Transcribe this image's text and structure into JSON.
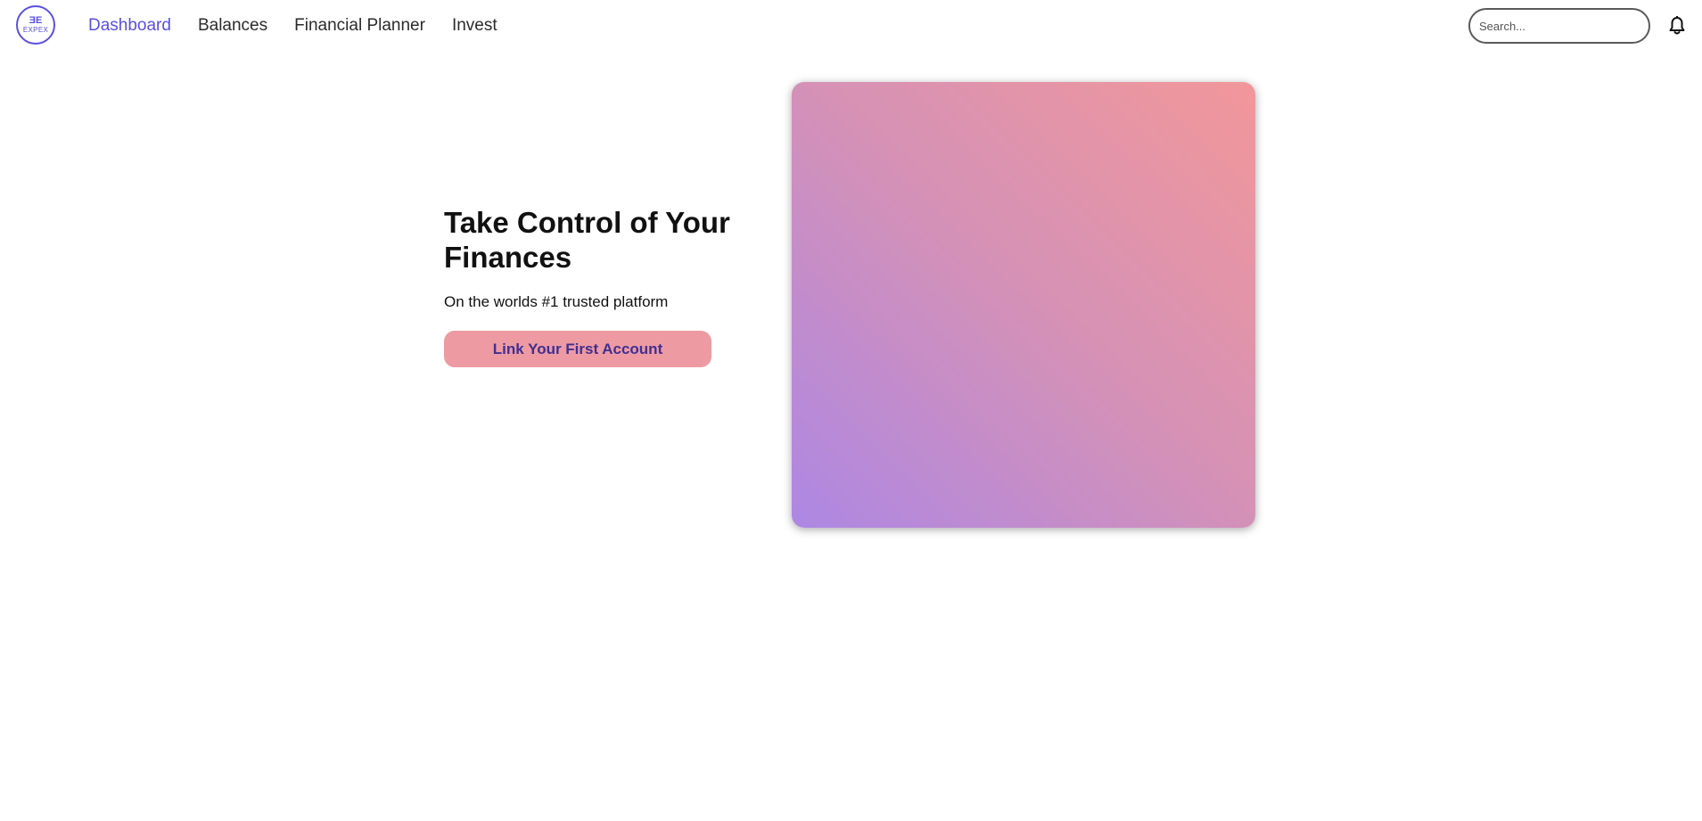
{
  "brand": {
    "logo_mark": "ƎE",
    "logo_text": "EXPEX",
    "accent_color": "#5b4fe0"
  },
  "nav": {
    "items": [
      {
        "label": "Dashboard",
        "active": true
      },
      {
        "label": "Balances",
        "active": false
      },
      {
        "label": "Financial Planner",
        "active": false
      },
      {
        "label": "Invest",
        "active": false
      }
    ]
  },
  "search": {
    "placeholder": "Search...",
    "value": ""
  },
  "icons": {
    "notifications": "bell-icon"
  },
  "hero": {
    "title": "Take Control of Your Finances",
    "subtitle": "On the worlds #1 trusted platform",
    "cta_label": "Link Your First Account",
    "cta_color": "#ee9aa2",
    "cta_text_color": "#3f2f93",
    "card_gradient": [
      "#ad87e4",
      "#d491b7",
      "#f2979a"
    ]
  }
}
